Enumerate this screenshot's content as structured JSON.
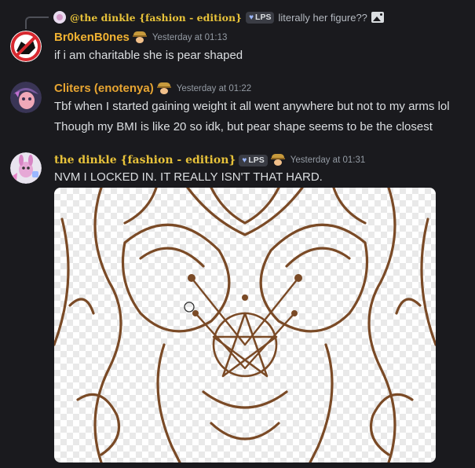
{
  "reply": {
    "author": "@the dinkle {fashion - edition}",
    "tag": "LPS",
    "text": "literally her figure??"
  },
  "messages": [
    {
      "author": "Br0kenB0nes",
      "author_color": "#f0b232",
      "timestamp": "Yesterday at 01:13",
      "lines": [
        "if i am charitable she is pear shaped"
      ]
    },
    {
      "author": "Cliters (enotenya)",
      "author_color": "#e7a532",
      "timestamp": "Yesterday at 01:22",
      "lines": [
        "Tbf when I started gaining weight it all went anywhere but not to my arms lol",
        "Though my BMI is like 20 so idk, but pear shape seems to be the closest"
      ]
    },
    {
      "author": "the dinkle {fashion - edition}",
      "author_color": "#e7c23a",
      "tag": "LPS",
      "timestamp": "Yesterday at 01:31",
      "lines": [
        "NVM I LOCKED IN. IT REALLY ISN'T THAT HARD."
      ],
      "attachment": {
        "kind": "line-art sketch",
        "line_color": "#7a4a26"
      }
    }
  ]
}
